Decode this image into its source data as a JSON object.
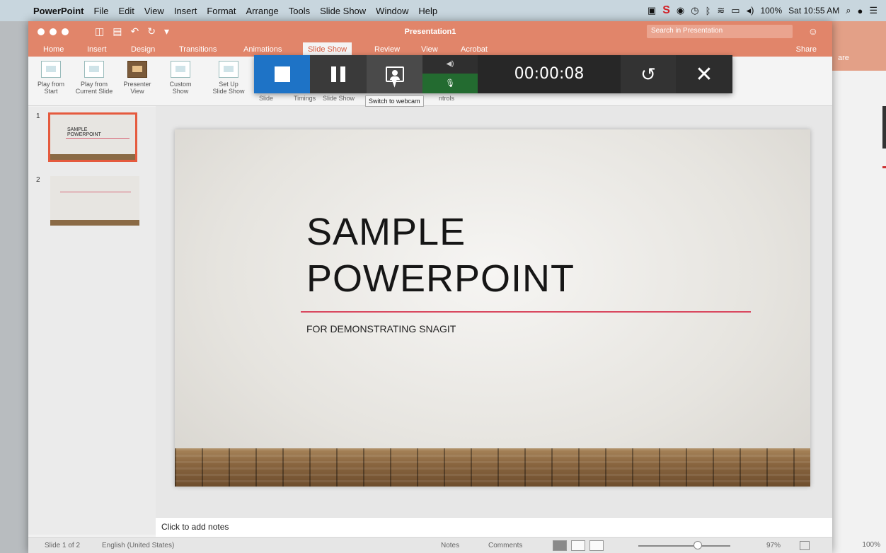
{
  "menubar": {
    "apple_icon": "",
    "app_name": "PowerPoint",
    "items": [
      "File",
      "Edit",
      "View",
      "Insert",
      "Format",
      "Arrange",
      "Tools",
      "Slide Show",
      "Window",
      "Help"
    ],
    "battery": "100%",
    "clock": "Sat 10:55 AM"
  },
  "window": {
    "title": "Presentation1",
    "search_placeholder": "Search in Presentation",
    "tabs": [
      "Home",
      "Insert",
      "Design",
      "Transitions",
      "Animations",
      "Slide Show",
      "Review",
      "View",
      "Acrobat"
    ],
    "active_tab": "Slide Show",
    "share_label": "Share"
  },
  "ribbon": {
    "buttons": [
      {
        "line1": "Play from",
        "line2": "Start"
      },
      {
        "line1": "Play from",
        "line2": "Current Slide"
      },
      {
        "line1": "Presenter",
        "line2": "View"
      },
      {
        "line1": "Custom",
        "line2": "Show"
      },
      {
        "line1": "Set Up",
        "line2": "Slide Show"
      }
    ],
    "group_labels": [
      "Slide",
      "Timings",
      "Slide Show"
    ],
    "partial_label": "ntrols"
  },
  "thumbnails": [
    {
      "number": "1",
      "title_line1": "SAMPLE",
      "title_line2": "POWERPOINT"
    },
    {
      "number": "2"
    }
  ],
  "slide": {
    "title_line1": "SAMPLE",
    "title_line2": "POWERPOINT",
    "subtitle": "FOR DEMONSTRATING SNAGIT"
  },
  "notes_placeholder": "Click to add notes",
  "statusbar": {
    "slide_counter": "Slide 1 of 2",
    "language": "English (United States)",
    "notes_label": "Notes",
    "comments_label": "Comments",
    "zoom": "97%"
  },
  "background_window": {
    "share_fragment": "are",
    "zoom": "100%"
  },
  "recorder": {
    "timer": "00:00:08",
    "tooltip": "Switch to webcam",
    "colors": {
      "stop": "#1e73c6",
      "mic_on": "#236b30",
      "bar": "#272727"
    }
  }
}
